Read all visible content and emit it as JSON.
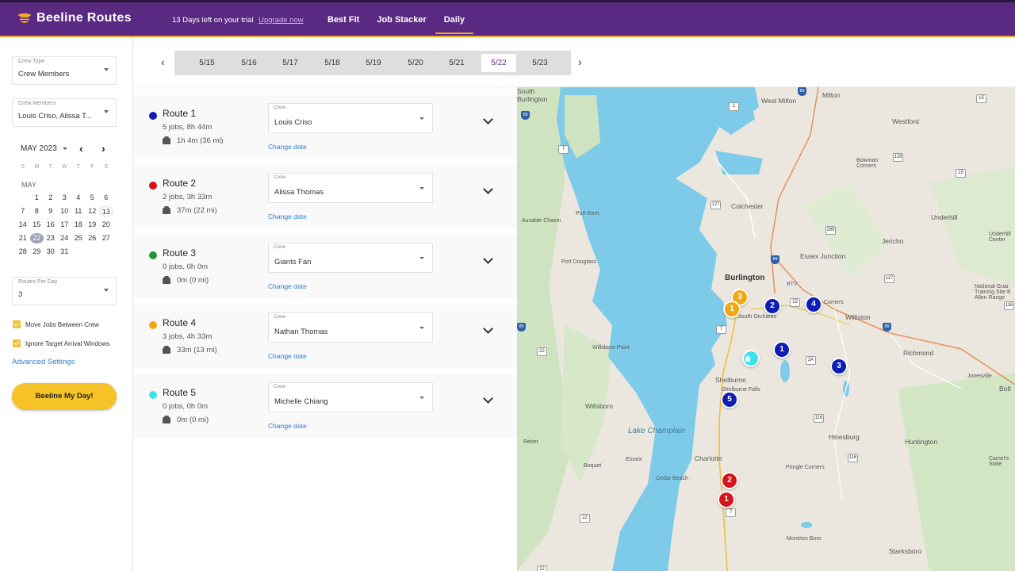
{
  "header": {
    "brand": "Beeline Routes",
    "trial_text": "13 Days left on your trial",
    "upgrade_link": "Upgrade now",
    "tabs": [
      {
        "label": "Best Fit"
      },
      {
        "label": "Job Stacker"
      },
      {
        "label": "Daily",
        "active": true
      }
    ],
    "brand_color": "#5a2a82",
    "accent_color": "#f3a823"
  },
  "sidebar": {
    "crew_type": {
      "label": "Crew Type",
      "value": "Crew Members"
    },
    "crew_members": {
      "label": "Crew Members",
      "value": "Louis Criso, Alissa T..."
    },
    "calendar": {
      "month_label": "MAY 2023",
      "weekdays": [
        "S",
        "M",
        "T",
        "W",
        "T",
        "F",
        "S"
      ],
      "month_name": "MAY",
      "days": [
        "",
        "1",
        "2",
        "3",
        "4",
        "5",
        "6",
        "7",
        "8",
        "9",
        "10",
        "11",
        "12",
        "13",
        "14",
        "15",
        "16",
        "17",
        "18",
        "19",
        "20",
        "21",
        "22",
        "23",
        "24",
        "25",
        "26",
        "27",
        "28",
        "29",
        "30",
        "31",
        "",
        "",
        ""
      ],
      "today": "13",
      "selected": "22"
    },
    "routes_per_day": {
      "label": "Routes Per Day",
      "value": "3"
    },
    "options": [
      {
        "label": "Move Jobs Between Crew",
        "checked": true
      },
      {
        "label": "Ignore Target Arrival Windows",
        "checked": true
      }
    ],
    "advanced_link": "Advanced Settings",
    "beeline_button": "Beeline My Day!"
  },
  "date_strip": {
    "dates": [
      "5/15",
      "5/16",
      "5/17",
      "5/18",
      "5/19",
      "5/20",
      "5/21",
      "5/22",
      "5/23"
    ],
    "active": "5/22"
  },
  "routes": [
    {
      "name": "Route 1",
      "color": "#0e1db3",
      "jobs": "5 jobs, 8h 44m",
      "drive": "1h 4m (36 mi)",
      "crew_label": "Crew",
      "crew": "Louis Criso",
      "change": "Change date"
    },
    {
      "name": "Route 2",
      "color": "#d5141c",
      "jobs": "2 jobs, 3h 33m",
      "drive": "37m (22 mi)",
      "crew_label": "Crew",
      "crew": "Alissa Thomas",
      "change": "Change date"
    },
    {
      "name": "Route 3",
      "color": "#1f9a2e",
      "jobs": "0 jobs, 0h 0m",
      "drive": "0m (0 mi)",
      "crew_label": "Crew",
      "crew": "Giants Fan",
      "change": "Change date"
    },
    {
      "name": "Route 4",
      "color": "#f2a611",
      "jobs": "3 jobs, 4h 33m",
      "drive": "33m (13 mi)",
      "crew_label": "Crew",
      "crew": "Nathan Thomas",
      "change": "Change date"
    },
    {
      "name": "Route 5",
      "color": "#3ee3ea",
      "jobs": "0 jobs, 0h 0m",
      "drive": "0m (0 mi)",
      "crew_label": "Crew",
      "crew": "Michelle Chiang",
      "change": "Change date"
    }
  ],
  "map": {
    "labels": {
      "south_burlington": "South\nBurlington",
      "milton": "Milton",
      "west_milton": "West Milton",
      "westford": "Westford",
      "bowman": "Bowman\nCorners",
      "colchester": "Colchester",
      "underhill": "Underhill",
      "underhill_center": "Underhill\nCenter",
      "jericho": "Jericho",
      "essex_junction": "Essex Junction",
      "port_kent": "Port Kent",
      "ausable": "Ausable Chasm",
      "port_douglass": "Port Douglass",
      "burlington": "Burlington",
      "btv": "BTV",
      "national_guard": "National Guar\nTraining Site E\nAllen Range",
      "south_orchards": "South Orchards",
      "corners": "Corners",
      "williston": "Williston",
      "willsboro_point": "Willsboro Point",
      "richmond": "Richmond",
      "jonesville": "Jonesville",
      "shelburne": "Shelburne",
      "shelburne_falls": "Shelburne Falls",
      "willsboro": "Willsboro",
      "lake_champlain": "Lake Champlain",
      "hinesburg": "Hinesburg",
      "huntington": "Huntington",
      "reber": "Reber",
      "charlotte": "Charlotte",
      "essex": "Essex",
      "pringle": "Pringle Corners",
      "boquet": "Boquet",
      "cedar_beach": "Cedar Beach",
      "camels": "Camel's\nState",
      "monkton": "Monkton Boro",
      "starksboro": "Starksboro",
      "bolton": "Bolt"
    },
    "markers": [
      {
        "num": "3",
        "color": "#f2a611"
      },
      {
        "num": "1",
        "color": "#f2a611"
      },
      {
        "num": "2",
        "color": "#0e1db3"
      },
      {
        "num": "4",
        "color": "#0e1db3"
      },
      {
        "num": "1",
        "color": "#0e1db3"
      },
      {
        "num": "3",
        "color": "#0e1db3"
      },
      {
        "num": "5",
        "color": "#0e1db3"
      },
      {
        "num": "2",
        "color": "#d5141c"
      },
      {
        "num": "1",
        "color": "#d5141c"
      }
    ],
    "home_icon": "home-icon",
    "shields": [
      "89",
      "2",
      "15",
      "89",
      "7",
      "128",
      "15",
      "127",
      "289",
      "89",
      "117",
      "15",
      "7",
      "89",
      "22",
      "2A",
      "116",
      "116",
      "89",
      "116",
      "7",
      "22",
      "22"
    ]
  }
}
